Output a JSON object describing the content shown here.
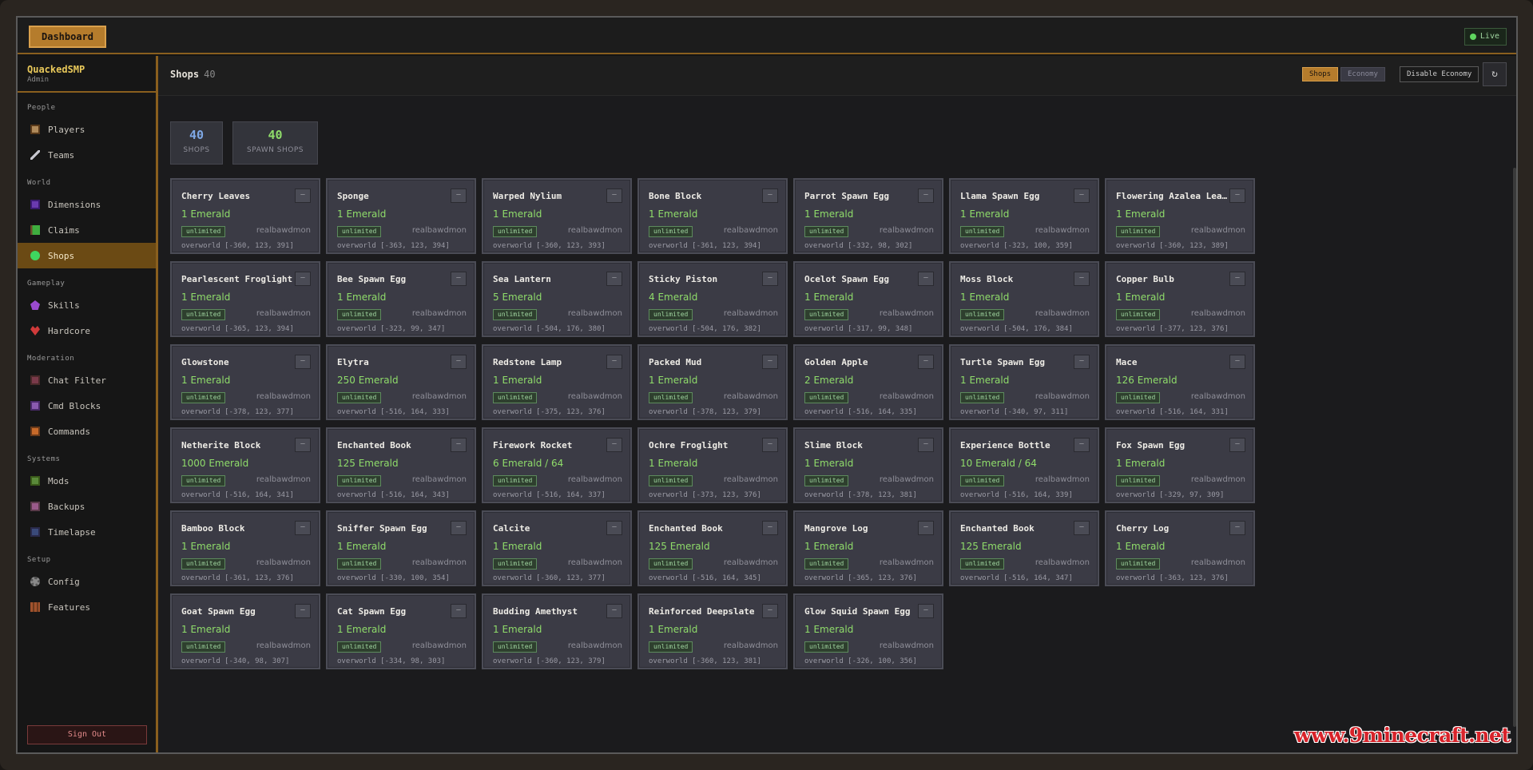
{
  "topbar": {
    "dashboard_label": "Dashboard",
    "live_label": "Live"
  },
  "brand": {
    "name": "QuackedSMP",
    "role": "Admin"
  },
  "sidebar": {
    "sections": [
      {
        "title": "People",
        "items": [
          {
            "label": "Players",
            "icon": "player-icon"
          },
          {
            "label": "Teams",
            "icon": "sword-icon"
          }
        ]
      },
      {
        "title": "World",
        "items": [
          {
            "label": "Dimensions",
            "icon": "portal-icon"
          },
          {
            "label": "Claims",
            "icon": "flag-icon"
          },
          {
            "label": "Shops",
            "icon": "emerald-icon",
            "active": true
          }
        ]
      },
      {
        "title": "Gameplay",
        "items": [
          {
            "label": "Skills",
            "icon": "skill-icon"
          },
          {
            "label": "Hardcore",
            "icon": "heart-icon"
          }
        ]
      },
      {
        "title": "Moderation",
        "items": [
          {
            "label": "Chat Filter",
            "icon": "chat-filter-icon"
          },
          {
            "label": "Cmd Blocks",
            "icon": "command-block-icon"
          },
          {
            "label": "Commands",
            "icon": "commands-icon"
          }
        ]
      },
      {
        "title": "Systems",
        "items": [
          {
            "label": "Mods",
            "icon": "mods-icon"
          },
          {
            "label": "Backups",
            "icon": "chest-icon"
          },
          {
            "label": "Timelapse",
            "icon": "camera-icon"
          }
        ]
      },
      {
        "title": "Setup",
        "items": [
          {
            "label": "Config",
            "icon": "gear-icon"
          },
          {
            "label": "Features",
            "icon": "bookshelf-icon"
          }
        ]
      }
    ],
    "signout_label": "Sign Out"
  },
  "header": {
    "title": "Shops",
    "count": "40",
    "tab_shops": "Shops",
    "tab_economy": "Economy",
    "disable_label": "Disable Economy",
    "refresh_icon": "refresh-icon"
  },
  "stats": [
    {
      "value": "40",
      "label": "SHOPS",
      "color": "#7fa8e6"
    },
    {
      "value": "40",
      "label": "SPAWN SHOPS",
      "color": "#8fdc6a"
    }
  ],
  "shops": [
    {
      "name": "Cherry Leaves",
      "price": "1 Emerald",
      "stock": "unlimited",
      "owner": "realbawdmon",
      "loc": "overworld [-360, 123, 391]"
    },
    {
      "name": "Sponge",
      "price": "1 Emerald",
      "stock": "unlimited",
      "owner": "realbawdmon",
      "loc": "overworld [-363, 123, 394]"
    },
    {
      "name": "Warped Nylium",
      "price": "1 Emerald",
      "stock": "unlimited",
      "owner": "realbawdmon",
      "loc": "overworld [-360, 123, 393]"
    },
    {
      "name": "Bone Block",
      "price": "1 Emerald",
      "stock": "unlimited",
      "owner": "realbawdmon",
      "loc": "overworld [-361, 123, 394]"
    },
    {
      "name": "Parrot Spawn Egg",
      "price": "1 Emerald",
      "stock": "unlimited",
      "owner": "realbawdmon",
      "loc": "overworld [-332, 98, 302]"
    },
    {
      "name": "Llama Spawn Egg",
      "price": "1 Emerald",
      "stock": "unlimited",
      "owner": "realbawdmon",
      "loc": "overworld [-323, 100, 359]"
    },
    {
      "name": "Flowering Azalea Lea…",
      "price": "1 Emerald",
      "stock": "unlimited",
      "owner": "realbawdmon",
      "loc": "overworld [-360, 123, 389]"
    },
    {
      "name": "Pearlescent Froglight",
      "price": "1 Emerald",
      "stock": "unlimited",
      "owner": "realbawdmon",
      "loc": "overworld [-365, 123, 394]"
    },
    {
      "name": "Bee Spawn Egg",
      "price": "1 Emerald",
      "stock": "unlimited",
      "owner": "realbawdmon",
      "loc": "overworld [-323, 99, 347]"
    },
    {
      "name": "Sea Lantern",
      "price": "5 Emerald",
      "stock": "unlimited",
      "owner": "realbawdmon",
      "loc": "overworld [-504, 176, 380]"
    },
    {
      "name": "Sticky Piston",
      "price": "4 Emerald",
      "stock": "unlimited",
      "owner": "realbawdmon",
      "loc": "overworld [-504, 176, 382]"
    },
    {
      "name": "Ocelot Spawn Egg",
      "price": "1 Emerald",
      "stock": "unlimited",
      "owner": "realbawdmon",
      "loc": "overworld [-317, 99, 348]"
    },
    {
      "name": "Moss Block",
      "price": "1 Emerald",
      "stock": "unlimited",
      "owner": "realbawdmon",
      "loc": "overworld [-504, 176, 384]"
    },
    {
      "name": "Copper Bulb",
      "price": "1 Emerald",
      "stock": "unlimited",
      "owner": "realbawdmon",
      "loc": "overworld [-377, 123, 376]"
    },
    {
      "name": "Glowstone",
      "price": "1 Emerald",
      "stock": "unlimited",
      "owner": "realbawdmon",
      "loc": "overworld [-378, 123, 377]"
    },
    {
      "name": "Elytra",
      "price": "250 Emerald",
      "stock": "unlimited",
      "owner": "realbawdmon",
      "loc": "overworld [-516, 164, 333]"
    },
    {
      "name": "Redstone Lamp",
      "price": "1 Emerald",
      "stock": "unlimited",
      "owner": "realbawdmon",
      "loc": "overworld [-375, 123, 376]"
    },
    {
      "name": "Packed Mud",
      "price": "1 Emerald",
      "stock": "unlimited",
      "owner": "realbawdmon",
      "loc": "overworld [-378, 123, 379]"
    },
    {
      "name": "Golden Apple",
      "price": "2 Emerald",
      "stock": "unlimited",
      "owner": "realbawdmon",
      "loc": "overworld [-516, 164, 335]"
    },
    {
      "name": "Turtle Spawn Egg",
      "price": "1 Emerald",
      "stock": "unlimited",
      "owner": "realbawdmon",
      "loc": "overworld [-340, 97, 311]"
    },
    {
      "name": "Mace",
      "price": "126 Emerald",
      "stock": "unlimited",
      "owner": "realbawdmon",
      "loc": "overworld [-516, 164, 331]"
    },
    {
      "name": "Netherite Block",
      "price": "1000 Emerald",
      "stock": "unlimited",
      "owner": "realbawdmon",
      "loc": "overworld [-516, 164, 341]"
    },
    {
      "name": "Enchanted Book",
      "price": "125 Emerald",
      "stock": "unlimited",
      "owner": "realbawdmon",
      "loc": "overworld [-516, 164, 343]"
    },
    {
      "name": "Firework Rocket",
      "price": "6 Emerald / 64",
      "stock": "unlimited",
      "owner": "realbawdmon",
      "loc": "overworld [-516, 164, 337]"
    },
    {
      "name": "Ochre Froglight",
      "price": "1 Emerald",
      "stock": "unlimited",
      "owner": "realbawdmon",
      "loc": "overworld [-373, 123, 376]"
    },
    {
      "name": "Slime Block",
      "price": "1 Emerald",
      "stock": "unlimited",
      "owner": "realbawdmon",
      "loc": "overworld [-378, 123, 381]"
    },
    {
      "name": "Experience Bottle",
      "price": "10 Emerald / 64",
      "stock": "unlimited",
      "owner": "realbawdmon",
      "loc": "overworld [-516, 164, 339]"
    },
    {
      "name": "Fox Spawn Egg",
      "price": "1 Emerald",
      "stock": "unlimited",
      "owner": "realbawdmon",
      "loc": "overworld [-329, 97, 309]"
    },
    {
      "name": "Bamboo Block",
      "price": "1 Emerald",
      "stock": "unlimited",
      "owner": "realbawdmon",
      "loc": "overworld [-361, 123, 376]"
    },
    {
      "name": "Sniffer Spawn Egg",
      "price": "1 Emerald",
      "stock": "unlimited",
      "owner": "realbawdmon",
      "loc": "overworld [-330, 100, 354]"
    },
    {
      "name": "Calcite",
      "price": "1 Emerald",
      "stock": "unlimited",
      "owner": "realbawdmon",
      "loc": "overworld [-360, 123, 377]"
    },
    {
      "name": "Enchanted Book",
      "price": "125 Emerald",
      "stock": "unlimited",
      "owner": "realbawdmon",
      "loc": "overworld [-516, 164, 345]"
    },
    {
      "name": "Mangrove Log",
      "price": "1 Emerald",
      "stock": "unlimited",
      "owner": "realbawdmon",
      "loc": "overworld [-365, 123, 376]"
    },
    {
      "name": "Enchanted Book",
      "price": "125 Emerald",
      "stock": "unlimited",
      "owner": "realbawdmon",
      "loc": "overworld [-516, 164, 347]"
    },
    {
      "name": "Cherry Log",
      "price": "1 Emerald",
      "stock": "unlimited",
      "owner": "realbawdmon",
      "loc": "overworld [-363, 123, 376]"
    },
    {
      "name": "Goat Spawn Egg",
      "price": "1 Emerald",
      "stock": "unlimited",
      "owner": "realbawdmon",
      "loc": "overworld [-340, 98, 307]"
    },
    {
      "name": "Cat Spawn Egg",
      "price": "1 Emerald",
      "stock": "unlimited",
      "owner": "realbawdmon",
      "loc": "overworld [-334, 98, 303]"
    },
    {
      "name": "Budding Amethyst",
      "price": "1 Emerald",
      "stock": "unlimited",
      "owner": "realbawdmon",
      "loc": "overworld [-360, 123, 379]"
    },
    {
      "name": "Reinforced Deepslate",
      "price": "1 Emerald",
      "stock": "unlimited",
      "owner": "realbawdmon",
      "loc": "overworld [-360, 123, 381]"
    },
    {
      "name": "Glow Squid Spawn Egg",
      "price": "1 Emerald",
      "stock": "unlimited",
      "owner": "realbawdmon",
      "loc": "overworld [-326, 100, 356]"
    }
  ],
  "watermark": "www.9minecraft.net"
}
